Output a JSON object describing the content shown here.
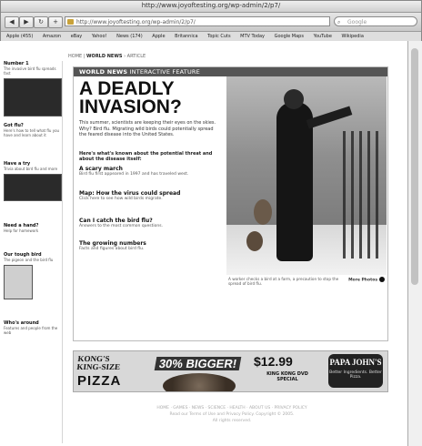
{
  "window": {
    "title": "http://www.joyoftesting.org/wp-admin/2/p7/"
  },
  "toolbar": {
    "back_icon": "◀",
    "forward_icon": "▶",
    "reload_icon": "↻",
    "plus_icon": "+",
    "address": "http://www.joyoftesting.org/wp-admin/2/p7/",
    "search_placeholder": "Google"
  },
  "bookmarks": [
    "Apple (455)",
    "Amazon",
    "eBay",
    "Yahoo!",
    "News (174)",
    "Apple",
    "Britannica",
    "Topic Cuts",
    "MTV Today",
    "Google Maps",
    "YouTube",
    "Wikipedia"
  ],
  "breadcrumbs": {
    "home": "HOME",
    "section": "WORLD NEWS",
    "rest": "› ARTICLE"
  },
  "sidebar": {
    "blocks": [
      {
        "title": "Number 1",
        "text": "The invasive bird flu spreads fast"
      },
      {
        "title": "Got flu?",
        "text": "Here's how to tell what flu you have and learn about it"
      },
      {
        "title": "Have a try",
        "text": "Trivia about bird flu and more"
      },
      {
        "title": "Need a hand?",
        "text": "Help for homework"
      },
      {
        "title": "Our tough bird",
        "text": "The pigeon and the bird flu"
      },
      {
        "title": "Who's around",
        "text": "Features and people from the web"
      }
    ]
  },
  "feature": {
    "bar_bold": "WORLD NEWS",
    "bar_rest": "INTERACTIVE FEATURE",
    "headline": "A DEADLY INVASION?",
    "deck": "This summer, scientists are keeping their eyes on the skies. Why? Bird flu. Migrating wild birds could potentially spread the feared disease into the United States.",
    "lead": "Here's what's known about the potential threat and about the disease itself:",
    "items": [
      {
        "title": "A scary march",
        "desc": "Bird flu first appeared in 1997 and has traveled west."
      },
      {
        "title": "Map: How the virus could spread",
        "desc": "Click here to see how wild birds migrate."
      },
      {
        "title": "Can I catch the bird flu?",
        "desc": "Answers to the most common questions."
      },
      {
        "title": "The growing numbers",
        "desc": "Facts and figures about bird flu."
      }
    ],
    "caption": "A worker checks a bird at a farm, a precaution to stop the spread of bird flu.",
    "more_photos": "More Photos"
  },
  "ad": {
    "brand": "KONG'S KING-SIZE",
    "product": "PIZZA",
    "promo": "30% BIGGER!",
    "price": "$12.99",
    "offer": "KING KONG DVD SPECIAL",
    "logo_text": "PAPA JOHN'S",
    "logo_tagline": "Better Ingredients. Better Pizza."
  },
  "footer": {
    "line1": "HOME · GAMES · NEWS · SCIENCE · HEALTH · ABOUT US · PRIVACY POLICY",
    "line2": "Read our Terms of Use and Privacy Policy. Copyright © 2005.",
    "line3": "All rights reserved."
  },
  "colors": {
    "feature_bar": "#555555",
    "page_bg": "#ffffff"
  }
}
